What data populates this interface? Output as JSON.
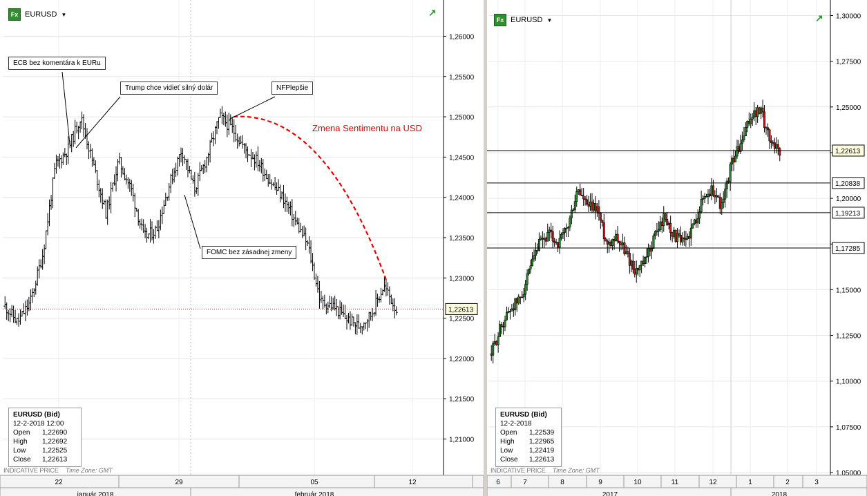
{
  "left": {
    "symbol": "EURUSD",
    "symbol_icon": "Fx",
    "info": {
      "title": "EURUSD (Bid)",
      "datetime": "12-2-2018 12:00",
      "rows": [
        {
          "k": "Open",
          "v": "1,22690"
        },
        {
          "k": "High",
          "v": "1,22692"
        },
        {
          "k": "Low",
          "v": "1,22525"
        },
        {
          "k": "Close",
          "v": "1,22613"
        }
      ]
    },
    "indicative": "INDICATIVE PRICE",
    "timezone": "Time Zone: GMT",
    "annotations": {
      "ecb": "ECB bez komentára k EURu",
      "trump": "Trump chce vidieť silný dolár",
      "nfp": "NFPlepšie",
      "fomc": "FOMC bez zásadnej zmeny"
    },
    "sentiment": "Zmena Sentimentu na USD",
    "sentiment_color": "#e30000"
  },
  "right": {
    "symbol": "EURUSD",
    "symbol_icon": "Fx",
    "info": {
      "title": "EURUSD (Bid)",
      "datetime": "12-2-2018",
      "rows": [
        {
          "k": "Open",
          "v": "1,22539"
        },
        {
          "k": "High",
          "v": "1,22965"
        },
        {
          "k": "Low",
          "v": "1,22419"
        },
        {
          "k": "Close",
          "v": "1,22613"
        }
      ]
    },
    "indicative": "INDICATIVE PRICE",
    "timezone": "Time Zone: GMT"
  },
  "chart_data": [
    {
      "type": "candlestick",
      "symbol": "EURUSD",
      "timeframe_note": "hourly bars, January–February 2018",
      "y_ticks": [
        "1,26000",
        "1,25500",
        "1,25000",
        "1,24500",
        "1,24000",
        "1,23500",
        "1,23000",
        "1,22500",
        "1,22000",
        "1,21500",
        "1,21000"
      ],
      "ylim": [
        1.2055,
        1.2645
      ],
      "x_ticks": [
        "22",
        "29",
        "05",
        "12"
      ],
      "x_months": [
        "január 2018",
        "február 2018"
      ],
      "last_price": "1,22613",
      "last_price_value": 1.22613,
      "price_path": [
        {
          "x": "17 Jan",
          "y": 1.2265
        },
        {
          "x": "18 Jan",
          "y": 1.2245
        },
        {
          "x": "19 Jan",
          "y": 1.227
        },
        {
          "x": "20 Jan",
          "y": 1.233
        },
        {
          "x": "21 Jan",
          "y": 1.244
        },
        {
          "x": "22 Jan",
          "y": 1.246
        },
        {
          "x": "23 Jan",
          "y": 1.25
        },
        {
          "x": "23 Jan",
          "y": 1.244
        },
        {
          "x": "24 Jan",
          "y": 1.238
        },
        {
          "x": "24 Jan",
          "y": 1.2445
        },
        {
          "x": "25 Jan",
          "y": 1.241
        },
        {
          "x": "26 Jan",
          "y": 1.235
        },
        {
          "x": "27 Jan",
          "y": 1.236
        },
        {
          "x": "28 Jan",
          "y": 1.2415
        },
        {
          "x": "29 Jan",
          "y": 1.246
        },
        {
          "x": "30 Jan",
          "y": 1.241
        },
        {
          "x": "31 Jan",
          "y": 1.245
        },
        {
          "x": "1 Feb",
          "y": 1.25
        },
        {
          "x": "1 Feb",
          "y": 1.2485
        },
        {
          "x": "2 Feb",
          "y": 1.246
        },
        {
          "x": "2 Feb",
          "y": 1.2445
        },
        {
          "x": "3 Feb",
          "y": 1.242
        },
        {
          "x": "4 Feb",
          "y": 1.24
        },
        {
          "x": "4 Feb",
          "y": 1.237
        },
        {
          "x": "5 Feb",
          "y": 1.234
        },
        {
          "x": "6 Feb",
          "y": 1.227
        },
        {
          "x": "7 Feb",
          "y": 1.2265
        },
        {
          "x": "8 Feb",
          "y": 1.225
        },
        {
          "x": "9 Feb",
          "y": 1.224
        },
        {
          "x": "10 Feb",
          "y": 1.2255
        },
        {
          "x": "11 Feb",
          "y": 1.229
        },
        {
          "x": "12 Feb",
          "y": 1.2261
        }
      ],
      "events": [
        {
          "label": "ECB bez komentára k EURu",
          "price": 1.2465
        },
        {
          "label": "Trump chce vidieť silný dolár",
          "price": 1.2455
        },
        {
          "label": "NFPlepšie",
          "price": 1.249
        },
        {
          "label": "FOMC bez zásadnej zmeny",
          "price": 1.24
        }
      ],
      "trend_curve": {
        "label": "Zmena Sentimentu na USD",
        "from": 1.25,
        "to": 1.2295,
        "color": "#e30000",
        "style": "dashed"
      }
    },
    {
      "type": "candlestick",
      "symbol": "EURUSD",
      "timeframe_note": "daily bars, June 2017 – February 2018",
      "y_ticks": [
        "1,30000",
        "1,27500",
        "1,25000",
        "1,22500",
        "1,20000",
        "1,17500",
        "1,15000",
        "1,12500",
        "1,10000",
        "1,07500",
        "1,05000"
      ],
      "ylim": [
        1.0485,
        1.3085
      ],
      "x_ticks": [
        "6",
        "7",
        "8",
        "9",
        "10",
        "11",
        "12",
        "1",
        "2",
        "3"
      ],
      "x_years": [
        "2017",
        "2018"
      ],
      "levels": [
        {
          "label": "1,22613",
          "value": 1.22613
        },
        {
          "label": "1,20838",
          "value": 1.20838
        },
        {
          "label": "1,19213",
          "value": 1.19213
        },
        {
          "label": "1,17285",
          "value": 1.17285
        }
      ],
      "price_path": [
        {
          "x": "Jun 2017",
          "y": 1.115
        },
        {
          "x": "Jun 2017",
          "y": 1.13
        },
        {
          "x": "Jun 2017",
          "y": 1.14
        },
        {
          "x": "Jul 2017",
          "y": 1.145
        },
        {
          "x": "Jul 2017",
          "y": 1.16
        },
        {
          "x": "Jul 2017",
          "y": 1.175
        },
        {
          "x": "Aug 2017",
          "y": 1.18
        },
        {
          "x": "Aug 2017",
          "y": 1.175
        },
        {
          "x": "Aug 2017",
          "y": 1.185
        },
        {
          "x": "Sep 2017",
          "y": 1.205
        },
        {
          "x": "Sep 2017",
          "y": 1.195
        },
        {
          "x": "Sep 2017",
          "y": 1.195
        },
        {
          "x": "Oct 2017",
          "y": 1.175
        },
        {
          "x": "Oct 2017",
          "y": 1.18
        },
        {
          "x": "Oct 2017",
          "y": 1.17
        },
        {
          "x": "Nov 2017",
          "y": 1.16
        },
        {
          "x": "Nov 2017",
          "y": 1.165
        },
        {
          "x": "Nov 2017",
          "y": 1.18
        },
        {
          "x": "Nov 2017",
          "y": 1.19
        },
        {
          "x": "Dec 2017",
          "y": 1.18
        },
        {
          "x": "Dec 2017",
          "y": 1.175
        },
        {
          "x": "Dec 2017",
          "y": 1.185
        },
        {
          "x": "Jan 2018",
          "y": 1.2
        },
        {
          "x": "Jan 2018",
          "y": 1.205
        },
        {
          "x": "Jan 2018",
          "y": 1.195
        },
        {
          "x": "Jan 2018",
          "y": 1.22
        },
        {
          "x": "Jan 2018",
          "y": 1.23
        },
        {
          "x": "Feb 2018",
          "y": 1.245
        },
        {
          "x": "Feb 2018",
          "y": 1.248
        },
        {
          "x": "Feb 2018",
          "y": 1.232
        },
        {
          "x": "Feb 2018",
          "y": 1.2261
        }
      ]
    }
  ]
}
